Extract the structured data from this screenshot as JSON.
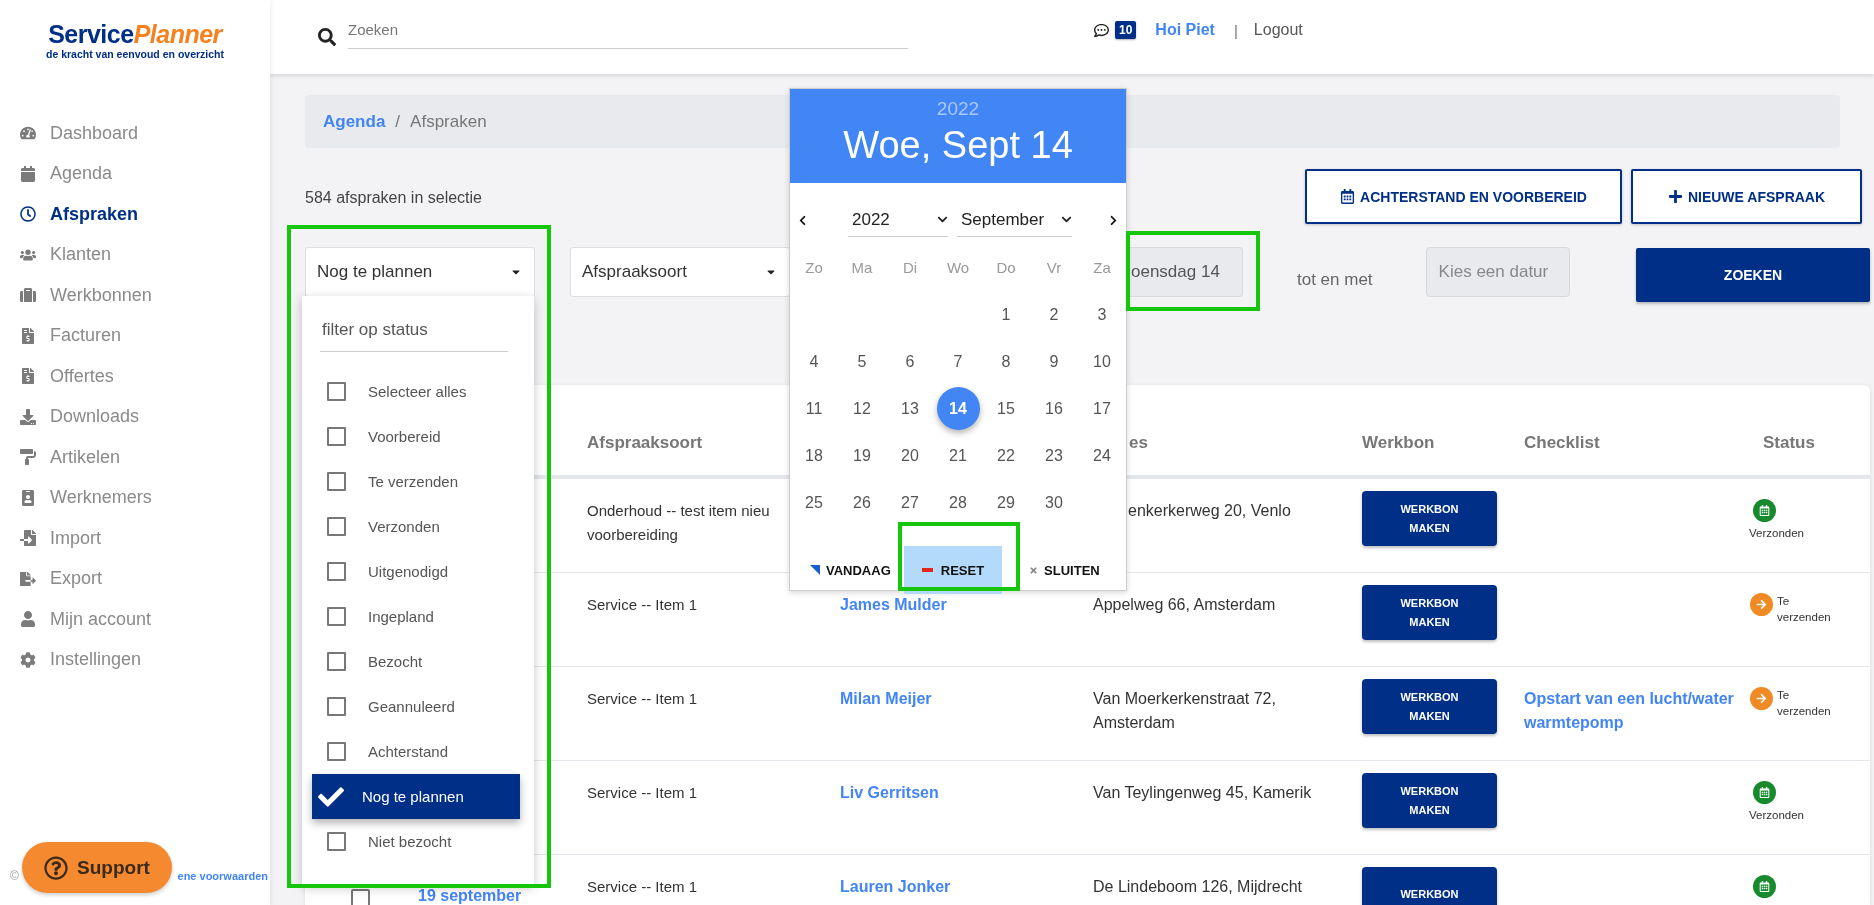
{
  "logo": {
    "word_1": "Service",
    "word_2": "Planner",
    "tagline": "de kracht van eenvoud en overzicht"
  },
  "sidebar": {
    "items": [
      {
        "label": "Dashboard",
        "kind": "gauge",
        "selected": false
      },
      {
        "label": "Agenda",
        "kind": "calendar",
        "selected": false
      },
      {
        "label": "Afspraken",
        "kind": "clock",
        "selected": true
      },
      {
        "label": "Klanten",
        "kind": "people",
        "selected": false
      },
      {
        "label": "Werkbonnen",
        "kind": "briefcase",
        "selected": false
      },
      {
        "label": "Facturen",
        "kind": "invoice",
        "selected": false
      },
      {
        "label": "Offertes",
        "kind": "invoice",
        "selected": false
      },
      {
        "label": "Downloads",
        "kind": "download",
        "selected": false
      },
      {
        "label": "Artikelen",
        "kind": "roller",
        "selected": false
      },
      {
        "label": "Werknemers",
        "kind": "badge",
        "selected": false
      },
      {
        "label": "Import",
        "kind": "import",
        "selected": false
      },
      {
        "label": "Export",
        "kind": "export",
        "selected": false
      },
      {
        "label": "Mijn account",
        "kind": "person",
        "selected": false
      },
      {
        "label": "Instellingen",
        "kind": "settings",
        "selected": false
      }
    ]
  },
  "footer": {
    "copyright": "©",
    "link": "ene voorwaarden"
  },
  "support_button": "Support",
  "header": {
    "search": {
      "placeholder": "Zoeken"
    },
    "message_count": "10",
    "greeting": "Hoi Piet",
    "separator": "|",
    "logout": "Logout"
  },
  "breadcrumb": {
    "items": [
      {
        "label": "Agenda",
        "link": true
      },
      {
        "label": "Afspraken",
        "link": false
      }
    ],
    "separator": "/"
  },
  "selection_count": "584 afspraken in selectie",
  "actions": [
    {
      "label": "ACHTERSTAND EN VOORBEREID",
      "kind": "calendar"
    },
    {
      "label": "NIEUWE AFSPRAAK",
      "kind": "plus"
    }
  ],
  "filters": {
    "status_select": {
      "value": "Nog te plannen"
    },
    "type_select": {
      "value": "Afspraaksoort"
    },
    "date_from": {
      "value": "oensdag 14"
    },
    "range_label": "tot en met",
    "date_to": {
      "placeholder": "Kies een datur"
    },
    "search_button": "ZOEKEN"
  },
  "status_dropdown": {
    "filter": {
      "placeholder": "filter op status"
    },
    "options": [
      {
        "label": "Selecteer alles",
        "checked": false
      },
      {
        "label": "Voorbereid",
        "checked": false
      },
      {
        "label": "Te verzenden",
        "checked": false
      },
      {
        "label": "Verzonden",
        "checked": false
      },
      {
        "label": "Uitgenodigd",
        "checked": false
      },
      {
        "label": "Ingepland",
        "checked": false
      },
      {
        "label": "Bezocht",
        "checked": false
      },
      {
        "label": "Geannuleerd",
        "checked": false
      },
      {
        "label": "Achterstand",
        "checked": false
      },
      {
        "label": "Nog te plannen",
        "checked": true
      },
      {
        "label": "Niet bezocht",
        "checked": false
      }
    ]
  },
  "datepicker": {
    "year": "2022",
    "title": "Woe, Sept 14",
    "year_select": "2022",
    "month_select": "September",
    "weekdays": [
      "Zo",
      "Ma",
      "Di",
      "Wo",
      "Do",
      "Vr",
      "Za"
    ],
    "weeks": [
      {
        "kind": "end",
        "days": [
          {
            "label": "1",
            "selected": false
          },
          {
            "label": "2",
            "selected": false
          },
          {
            "label": "3",
            "selected": false
          }
        ]
      },
      {
        "kind": "full",
        "days": [
          {
            "label": "4",
            "selected": false
          },
          {
            "label": "5",
            "selected": false
          },
          {
            "label": "6",
            "selected": false
          },
          {
            "label": "7",
            "selected": false
          },
          {
            "label": "8",
            "selected": false
          },
          {
            "label": "9",
            "selected": false
          },
          {
            "label": "10",
            "selected": false
          }
        ]
      },
      {
        "kind": "full",
        "days": [
          {
            "label": "11",
            "selected": false
          },
          {
            "label": "12",
            "selected": false
          },
          {
            "label": "13",
            "selected": false
          },
          {
            "label": "14",
            "selected": true
          },
          {
            "label": "15",
            "selected": false
          },
          {
            "label": "16",
            "selected": false
          },
          {
            "label": "17",
            "selected": false
          }
        ]
      },
      {
        "kind": "full",
        "days": [
          {
            "label": "18",
            "selected": false
          },
          {
            "label": "19",
            "selected": false
          },
          {
            "label": "20",
            "selected": false
          },
          {
            "label": "21",
            "selected": false
          },
          {
            "label": "22",
            "selected": false
          },
          {
            "label": "23",
            "selected": false
          },
          {
            "label": "24",
            "selected": false
          }
        ]
      },
      {
        "kind": "start",
        "days": [
          {
            "label": "25",
            "selected": false
          },
          {
            "label": "26",
            "selected": false
          },
          {
            "label": "27",
            "selected": false
          },
          {
            "label": "28",
            "selected": false
          },
          {
            "label": "29",
            "selected": false
          },
          {
            "label": "30",
            "selected": false
          }
        ]
      }
    ],
    "buttons": [
      {
        "label": "VANDAAG",
        "kind": "today",
        "highlighted": false
      },
      {
        "label": "RESET",
        "kind": "reset",
        "highlighted": true
      },
      {
        "label": "SLUITEN",
        "kind": "close",
        "highlighted": false
      }
    ]
  },
  "table": {
    "columns": [
      "Afspraaksoort",
      "es",
      "Werkbon",
      "Checklist",
      "Status"
    ],
    "rows": [
      {
        "type": "Onderhoud -- test item nieu voorbereiding",
        "address": "enkerkerweg 20, Venlo",
        "werkbon": "WERKBON MAKEN",
        "status": {
          "label": "Verzonden",
          "kind": "sent",
          "color": "#188a2e"
        }
      },
      {
        "type": "Service -- Item 1",
        "customer": "James Mulder",
        "address": "Appelweg 66, Amsterdam",
        "werkbon": "WERKBON MAKEN",
        "status": {
          "label": "Te verzenden",
          "kind": "to_send",
          "color": "#f08a24"
        }
      },
      {
        "type": "Service -- Item 1",
        "customer": "Milan Meijer",
        "address": "Van Moerkerkenstraat 72, Amsterdam",
        "werkbon": "WERKBON MAKEN",
        "checklist": "Opstart van een lucht/water warmtepomp",
        "status": {
          "label": "Te verzenden",
          "kind": "to_send",
          "color": "#f08a24"
        }
      },
      {
        "type": "Service -- Item 1",
        "customer": "Liv Gerritsen",
        "address": "Van Teylingenweg 45, Kamerik",
        "werkbon": "WERKBON MAKEN",
        "status": {
          "label": "Verzonden",
          "kind": "sent",
          "color": "#188a2e"
        }
      },
      {
        "selector": {
          "checked": false
        },
        "date": "19 september",
        "type": "Service -- Item 1",
        "customer": "Lauren Jonker",
        "address": "De Lindeboom 126, Mijdrecht",
        "werkbon": "WERKBON",
        "status": {
          "kind": "sent",
          "color": "#188a2e"
        }
      }
    ]
  }
}
